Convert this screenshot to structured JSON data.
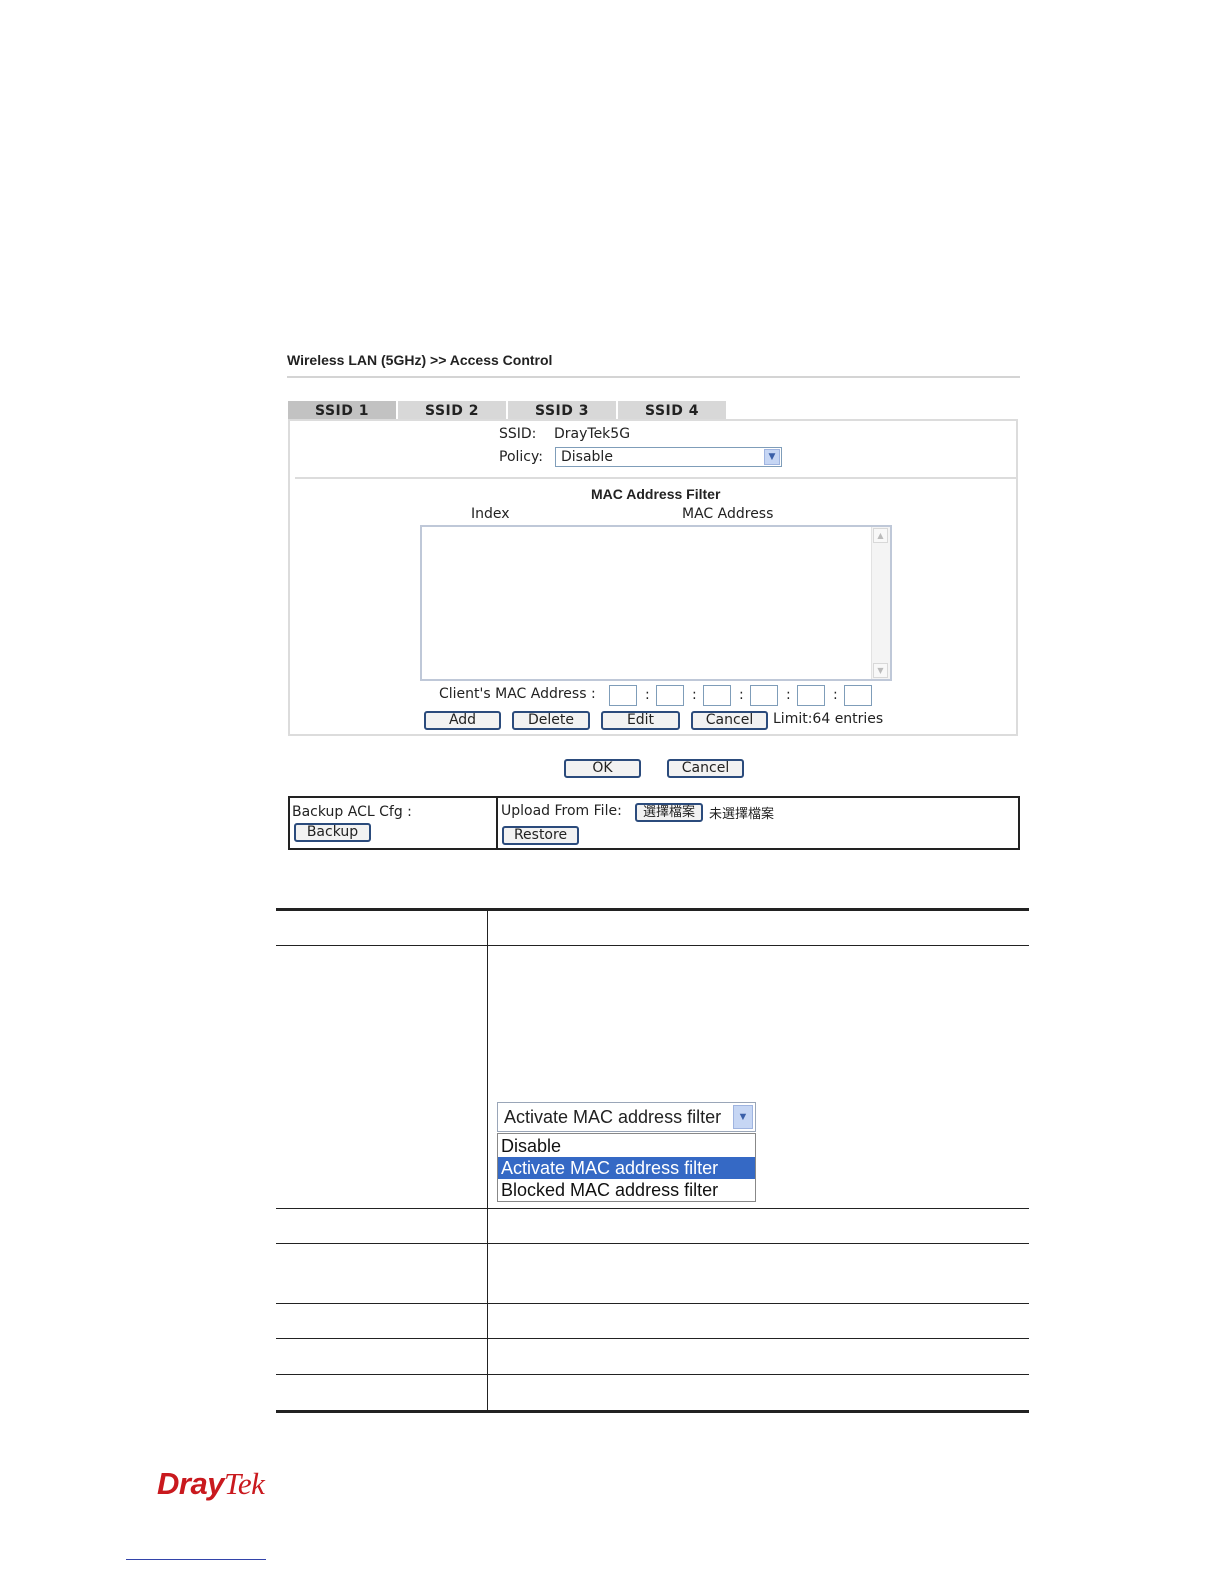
{
  "breadcrumb": "Wireless LAN (5GHz) >> Access Control",
  "tabs": [
    "SSID 1",
    "SSID 2",
    "SSID 3",
    "SSID 4"
  ],
  "ssid": {
    "label": "SSID:",
    "value": "DrayTek5G"
  },
  "policy": {
    "label": "Policy:",
    "value": "Disable"
  },
  "mac_filter": {
    "title": "MAC Address Filter",
    "col_index": "Index",
    "col_mac": "MAC Address",
    "client_label": "Client's MAC Address :",
    "separator": ":",
    "limit": "Limit:64 entries"
  },
  "buttons": {
    "add": "Add",
    "delete": "Delete",
    "edit": "Edit",
    "cancel": "Cancel",
    "ok": "OK",
    "cancel2": "Cancel",
    "backup": "Backup",
    "choose_file": "選擇檔案",
    "restore": "Restore"
  },
  "backup": {
    "label": "Backup ACL Cfg :",
    "upload_label": "Upload From File:",
    "no_file": "未選擇檔案"
  },
  "policy_dropdown": {
    "selected": "Activate MAC address filter",
    "options": [
      "Disable",
      "Activate MAC address filter",
      "Blocked MAC address filter"
    ],
    "highlighted_index": 1
  },
  "logo": {
    "dray": "Dray",
    "tek": "Tek"
  },
  "colors": {
    "logo_red": "#c9191e",
    "select_highlight": "#3569c5",
    "button_border": "#2b4b7c"
  }
}
